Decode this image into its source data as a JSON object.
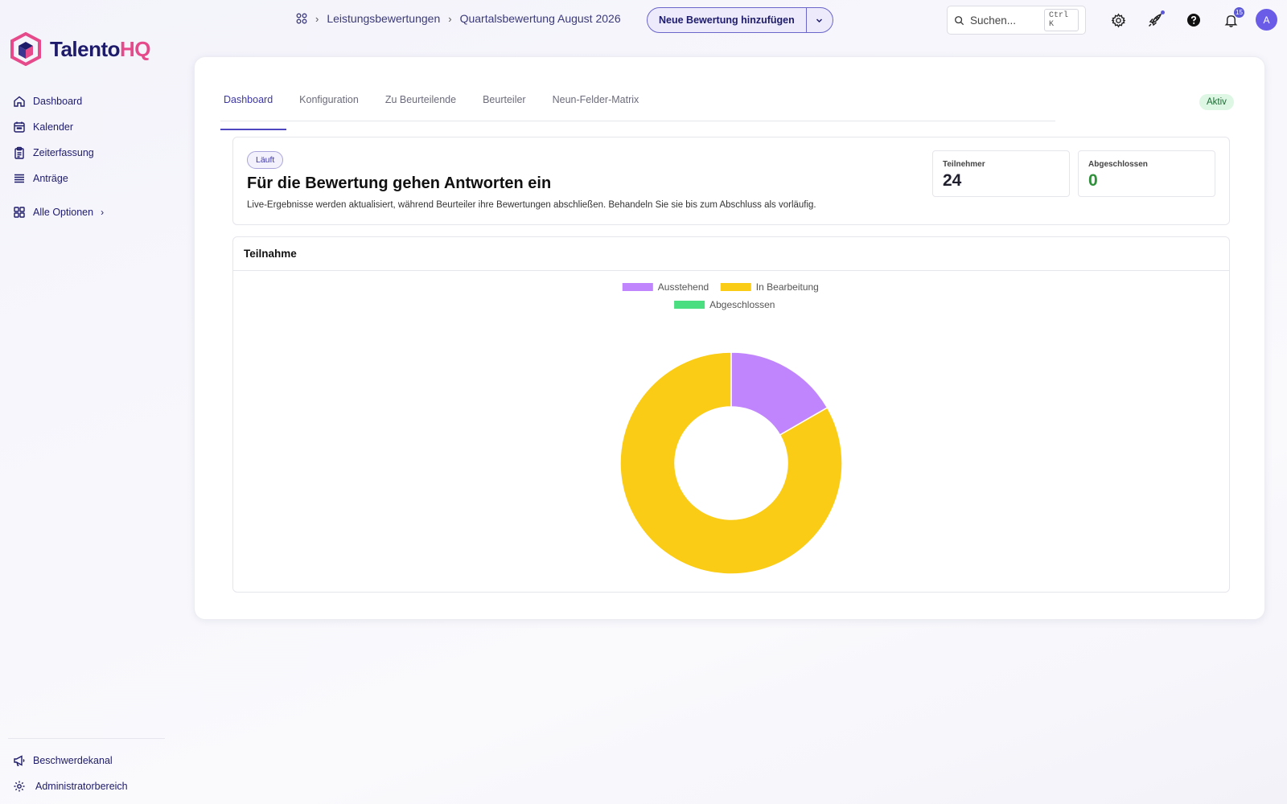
{
  "brand": {
    "part1": "Talento",
    "part2": "HQ",
    "colors": {
      "primary": "#1e1b6b",
      "accent": "#e64a8a"
    }
  },
  "sidebar": {
    "items": [
      {
        "label": "Dashboard",
        "icon": "home-icon"
      },
      {
        "label": "Kalender",
        "icon": "calendar-icon"
      },
      {
        "label": "Zeiterfassung",
        "icon": "clipboard-icon"
      },
      {
        "label": "Anträge",
        "icon": "stack-icon"
      }
    ],
    "all_options": "Alle Optionen",
    "bottom": [
      {
        "label": "Beschwerdekanal",
        "icon": "megaphone-icon"
      },
      {
        "label": "Administratorbereich",
        "icon": "gear-icon"
      }
    ]
  },
  "breadcrumb": {
    "items": [
      "Leistungsbewertungen",
      "Quartalsbewertung August 2026"
    ]
  },
  "header": {
    "add_button": "Neue Bewertung hinzufügen",
    "search_placeholder": "Suchen...",
    "search_shortcut": "Ctrl K",
    "notifications_count": "15",
    "avatar_initial": "A"
  },
  "tabs": [
    "Dashboard",
    "Konfiguration",
    "Zu Beurteilende",
    "Beurteiler",
    "Neun-Felder-Matrix"
  ],
  "status": "Aktiv",
  "summary": {
    "pill": "Läuft",
    "title": "Für die Bewertung gehen Antworten ein",
    "description": "Live-Ergebnisse werden aktualisiert, während Beurteiler ihre Bewertungen abschließen. Behandeln Sie sie bis zum Abschluss als vorläufig.",
    "stats": [
      {
        "label": "Teilnehmer",
        "value": "24",
        "color": "#1f1f2e"
      },
      {
        "label": "Abgeschlossen",
        "value": "0",
        "color": "#2f8f3a"
      }
    ]
  },
  "chart_card_title": "Teilnahme",
  "chart_data": {
    "type": "pie",
    "donut": true,
    "categories": [
      "Ausstehend",
      "In Bearbeitung",
      "Abgeschlossen"
    ],
    "values": [
      4,
      20,
      0
    ],
    "colors": [
      "#c084fc",
      "#facc15",
      "#4ade80"
    ],
    "legend": "top"
  }
}
